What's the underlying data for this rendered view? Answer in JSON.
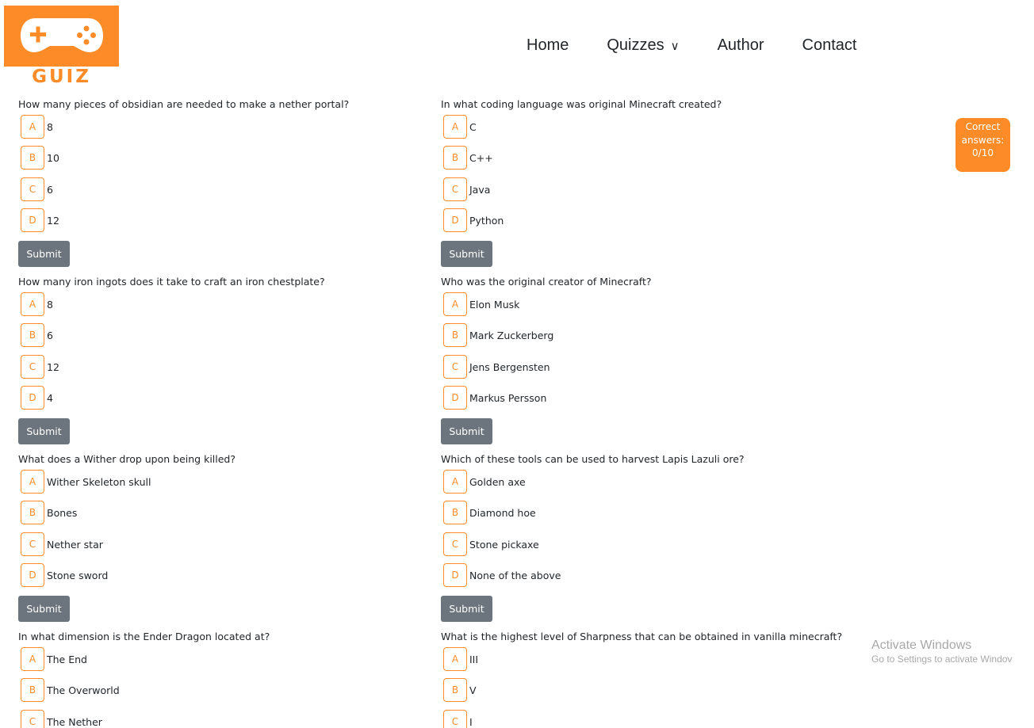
{
  "brand": {
    "logo_text": "GUIZ",
    "color": "#fd8c28"
  },
  "nav": {
    "home": "Home",
    "quizzes": "Quizzes",
    "author": "Author",
    "contact": "Contact"
  },
  "questions": [
    {
      "text": "How many pieces of obsidian are needed to make a nether portal?",
      "options": [
        {
          "letter": "A",
          "text": "8"
        },
        {
          "letter": "B",
          "text": "10"
        },
        {
          "letter": "C",
          "text": "6"
        },
        {
          "letter": "D",
          "text": "12"
        }
      ],
      "submit": "Submit"
    },
    {
      "text": "In what coding language was original Minecraft created?",
      "options": [
        {
          "letter": "A",
          "text": "C"
        },
        {
          "letter": "B",
          "text": "C++"
        },
        {
          "letter": "C",
          "text": "Java"
        },
        {
          "letter": "D",
          "text": "Python"
        }
      ],
      "submit": "Submit"
    },
    {
      "text": "How many iron ingots does it take to craft an iron chestplate?",
      "options": [
        {
          "letter": "A",
          "text": "8"
        },
        {
          "letter": "B",
          "text": "6"
        },
        {
          "letter": "C",
          "text": "12"
        },
        {
          "letter": "D",
          "text": "4"
        }
      ],
      "submit": "Submit"
    },
    {
      "text": "Who was the original creator of Minecraft?",
      "options": [
        {
          "letter": "A",
          "text": "Elon Musk"
        },
        {
          "letter": "B",
          "text": "Mark Zuckerberg"
        },
        {
          "letter": "C",
          "text": "Jens Bergensten"
        },
        {
          "letter": "D",
          "text": "Markus Persson"
        }
      ],
      "submit": "Submit"
    },
    {
      "text": "What does a Wither drop upon being killed?",
      "options": [
        {
          "letter": "A",
          "text": "Wither Skeleton skull"
        },
        {
          "letter": "B",
          "text": "Bones"
        },
        {
          "letter": "C",
          "text": "Nether star"
        },
        {
          "letter": "D",
          "text": "Stone sword"
        }
      ],
      "submit": "Submit"
    },
    {
      "text": "Which of these tools can be used to harvest Lapis Lazuli ore?",
      "options": [
        {
          "letter": "A",
          "text": "Golden axe"
        },
        {
          "letter": "B",
          "text": "Diamond hoe"
        },
        {
          "letter": "C",
          "text": "Stone pickaxe"
        },
        {
          "letter": "D",
          "text": "None of the above"
        }
      ],
      "submit": "Submit"
    },
    {
      "text": "In what dimension is the Ender Dragon located at?",
      "options": [
        {
          "letter": "A",
          "text": "The End"
        },
        {
          "letter": "B",
          "text": "The Overworld"
        },
        {
          "letter": "C",
          "text": "The Nether"
        }
      ]
    },
    {
      "text": "What is the highest level of Sharpness that can be obtained in vanilla minecraft?",
      "options": [
        {
          "letter": "A",
          "text": "III"
        },
        {
          "letter": "B",
          "text": "V"
        },
        {
          "letter": "C",
          "text": "I"
        }
      ]
    }
  ],
  "score": {
    "label_line1": "Correct",
    "label_line2": "answers:",
    "value": "0/10"
  },
  "watermark": {
    "title": "Activate Windows",
    "subtitle": "Go to Settings to activate Windov"
  }
}
